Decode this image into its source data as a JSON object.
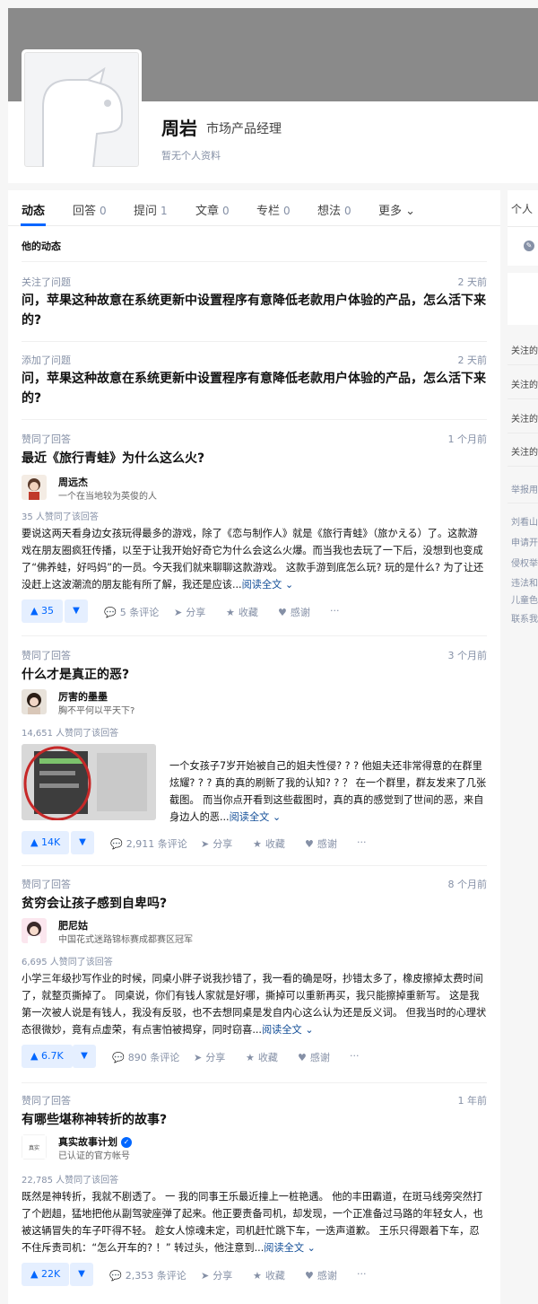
{
  "profile": {
    "name": "周岩",
    "title": "市场产品经理",
    "no_profile": "暂无个人资料"
  },
  "tabs": [
    {
      "label": "动态",
      "count": ""
    },
    {
      "label": "回答",
      "count": "0"
    },
    {
      "label": "提问",
      "count": "1"
    },
    {
      "label": "文章",
      "count": "0"
    },
    {
      "label": "专栏",
      "count": "0"
    },
    {
      "label": "想法",
      "count": "0"
    },
    {
      "label": "更多",
      "count": ""
    }
  ],
  "section_title": "他的动态",
  "items": [
    {
      "action": "关注了问题",
      "time": "2 天前",
      "question": "问，苹果这种故意在系统更新中设置程序有意降低老款用户体验的产品，怎么活下来的?"
    },
    {
      "action": "添加了问题",
      "time": "2 天前",
      "question": "问，苹果这种故意在系统更新中设置程序有意降低老款用户体验的产品，怎么活下来的?"
    },
    {
      "action": "赞同了回答",
      "time": "1 个月前",
      "question": "最近《旅行青蛙》为什么这么火?",
      "author_name": "周远杰",
      "author_headline": "一个在当地较为英俊的人",
      "votes_text": "35 人赞同了该回答",
      "excerpt": "要说这两天看身边女孩玩得最多的游戏，除了《恋与制作人》就是《旅行青蛙》（旅かえる）了。这款游戏在朋友圈疯狂传播，以至于让我开始好奇它为什么会这么火爆。而当我也去玩了一下后，没想到也变成了“佛养蛙，好吗妈”的一员。今天我们就来聊聊这款游戏。 这款手游到底怎么玩? 玩的是什么? 为了让还没赶上这波潮流的朋友能有所了解，我还是应该...",
      "read_more": "阅读全文 ⌄",
      "vote_count": "▲ 35",
      "comments": "5 条评论",
      "share": "分享",
      "favorite": "收藏",
      "thanks": "感谢",
      "more": "···"
    },
    {
      "action": "赞同了回答",
      "time": "3 个月前",
      "question": "什么才是真正的恶?",
      "author_name": "厉害的墨墨",
      "author_headline": "胸不平何以平天下?",
      "votes_text": "14,651 人赞同了该回答",
      "excerpt": "一个女孩子7岁开始被自己的姐夫性侵? ? ? 他姐夫还非常得意的在群里炫耀? ? ? 真的真的刷新了我的认知? ? ？ 在一个群里，群友发来了几张截图。 而当你点开看到这些截图时，真的真的感觉到了世间的恶，来自身边人的恶...",
      "read_more": "阅读全文 ⌄",
      "vote_count": "▲ 14K",
      "comments": "2,911 条评论",
      "share": "分享",
      "favorite": "收藏",
      "thanks": "感谢",
      "more": "···"
    },
    {
      "action": "赞同了回答",
      "time": "8 个月前",
      "question": "贫穷会让孩子感到自卑吗?",
      "author_name": "肥尼姑",
      "author_headline": "中国花式迷路锦标赛成都赛区冠军",
      "votes_text": "6,695 人赞同了该回答",
      "excerpt": "小学三年级抄写作业的时候，同桌小胖子说我抄错了，我一看的确是呀，抄错太多了，橡皮擦掉太费时间了，就整页撕掉了。 同桌说，你们有钱人家就是好哪，撕掉可以重新再买，我只能擦掉重新写。 这是我第一次被人说是有钱人，我没有反驳，也不去想同桌是发自内心这么认为还是反义词。 但我当时的心理状态很微妙，竟有点虚荣，有点害怕被揭穿，同时窃喜...",
      "read_more": "阅读全文 ⌄",
      "vote_count": "▲ 6.7K",
      "comments": "890 条评论",
      "share": "分享",
      "favorite": "收藏",
      "thanks": "感谢",
      "more": "···"
    },
    {
      "action": "赞同了回答",
      "time": "1 年前",
      "question": "有哪些堪称神转折的故事?",
      "author_name": "真实故事计划",
      "author_headline": "已认证的官方帐号",
      "votes_text": "22,785 人赞同了该回答",
      "excerpt": "既然是神转折，我就不剧透了。 一 我的同事王乐最近撞上一桩艳遇。 他的丰田霸道，在斑马线旁突然打了个趔趄，猛地把他从副驾驶座弹了起来。他正要责备司机，却发现，一个正准备过马路的年轻女人，也被这辆冒失的车子吓得不轻。 趁女人惊魂未定，司机赶忙跳下车，一迭声道歉。 王乐只得跟着下车，忍不住斥责司机：“怎么开车的? ！” 转过头，他注意到...",
      "read_more": "阅读全文 ⌄",
      "vote_count": "▲ 22K",
      "comments": "2,353 条评论",
      "share": "分享",
      "favorite": "收藏",
      "thanks": "感谢",
      "more": "···"
    }
  ],
  "sidebar": {
    "header": "个人",
    "links": [
      "关注的",
      "关注的",
      "关注的",
      "关注的"
    ],
    "report": "举报用",
    "footer": [
      "刘看山",
      "申请开",
      "侵权举",
      "违法和",
      "儿童色",
      "联系我"
    ]
  },
  "icons": {
    "comment": "comment-icon",
    "share": "share-icon",
    "star": "star-icon",
    "heart": "heart-icon",
    "pencil": "pencil-icon"
  },
  "colors": {
    "accent": "#0066ff",
    "vote_bg": "#e5efff",
    "meta": "#8590a6",
    "link": "#175199"
  }
}
